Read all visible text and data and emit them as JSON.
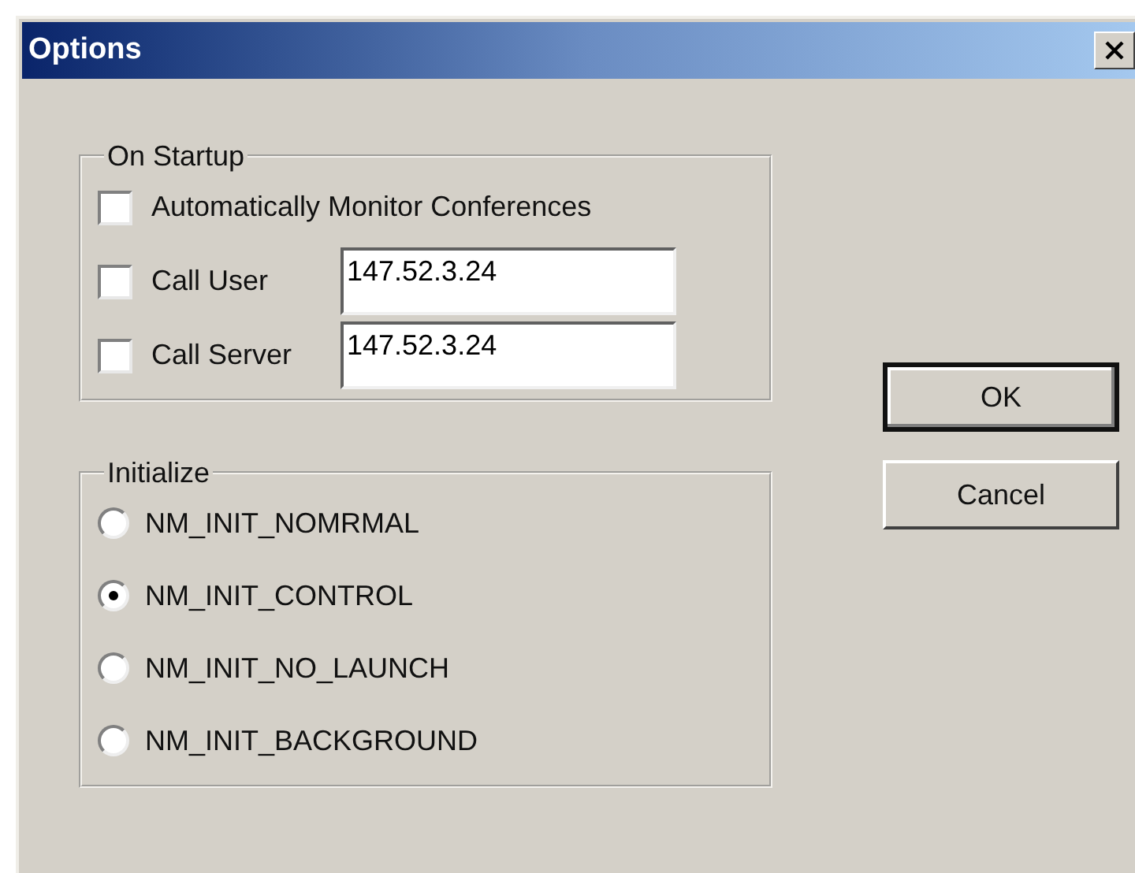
{
  "window": {
    "title": "Options"
  },
  "on_startup": {
    "label": "On Startup",
    "options": [
      {
        "label": "Automatically Monitor Conferences",
        "checked": false
      },
      {
        "label": "Call User",
        "checked": false,
        "value": "147.52.3.24"
      },
      {
        "label": "Call Server",
        "checked": false,
        "value": "147.52.3.24"
      }
    ]
  },
  "initialize": {
    "label": "Initialize",
    "options": [
      {
        "label": "NM_INIT_NOMRMAL",
        "selected": false
      },
      {
        "label": "NM_INIT_CONTROL",
        "selected": true
      },
      {
        "label": "NM_INIT_NO_LAUNCH",
        "selected": false
      },
      {
        "label": "NM_INIT_BACKGROUND",
        "selected": false
      }
    ]
  },
  "buttons": [
    {
      "label": "OK",
      "default": true
    },
    {
      "label": "Cancel",
      "default": false
    }
  ]
}
